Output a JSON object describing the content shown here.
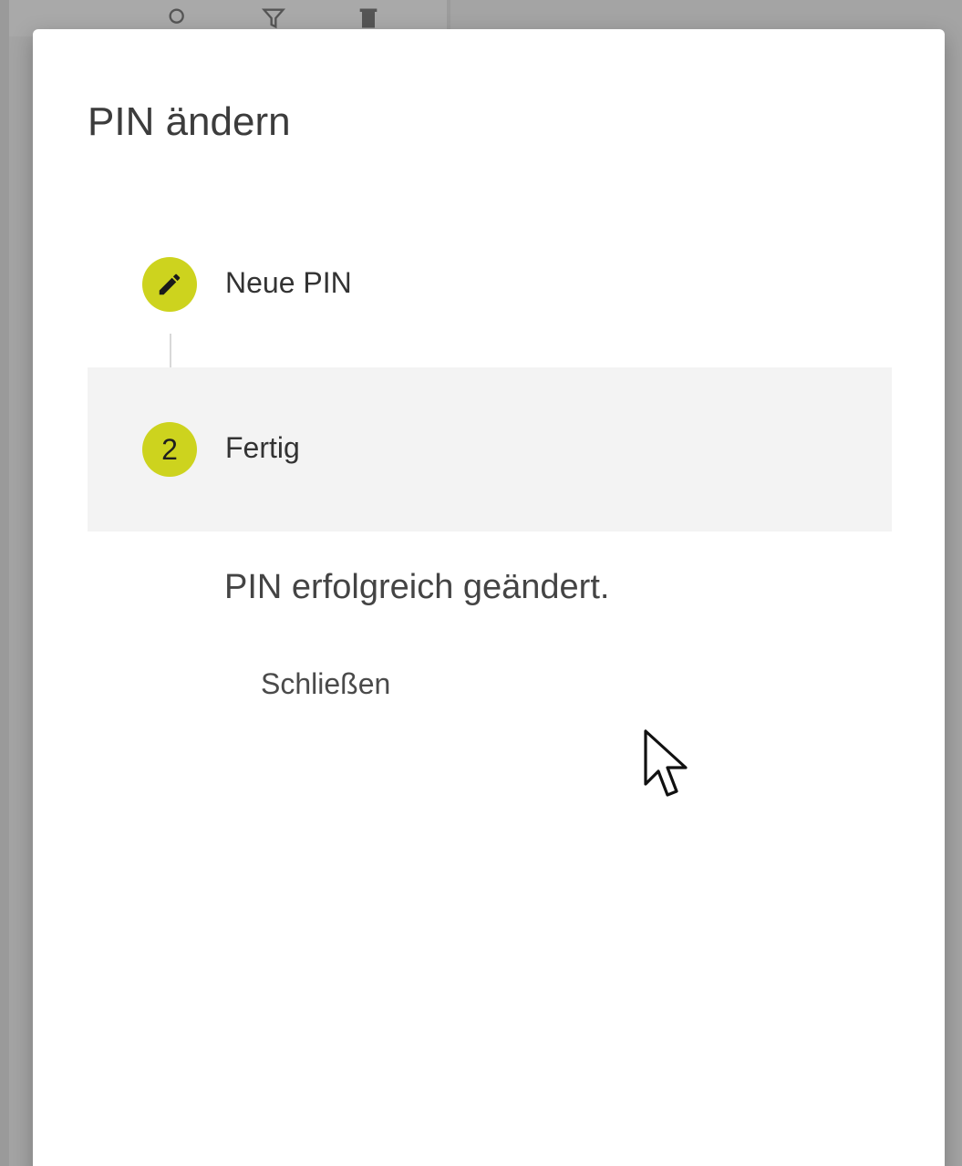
{
  "dialog": {
    "title": "PIN ändern",
    "steps": [
      {
        "icon": "pencil-icon",
        "label": "Neue PIN",
        "state": "edit"
      },
      {
        "number": "2",
        "label": "Fertig",
        "state": "active"
      }
    ],
    "message": "PIN erfolgreich geändert.",
    "close_label": "Schließen"
  },
  "colors": {
    "accent": "#cdd31e",
    "active_step_bg": "#f3f3f3",
    "overlay": "#a4a4a4"
  },
  "background_icons": [
    "search-icon",
    "filter-icon",
    "trash-icon"
  ]
}
